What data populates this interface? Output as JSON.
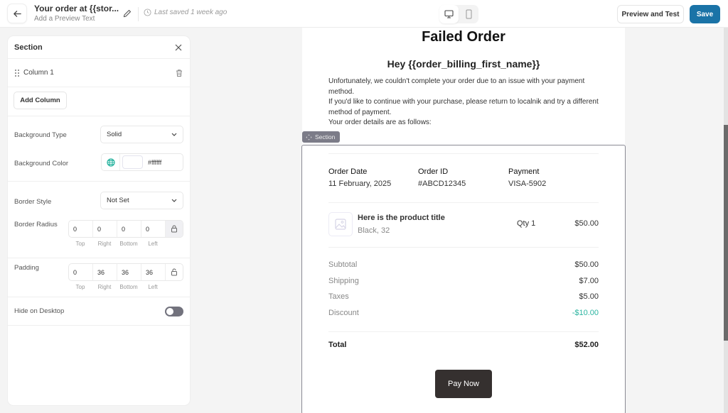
{
  "topbar": {
    "title": "Your order at {{stor...",
    "subtitle": "Add a Preview Text",
    "last_saved": "Last saved 1 week ago",
    "preview_label": "Preview and Test",
    "save_label": "Save",
    "active_device": "desktop"
  },
  "panel": {
    "title": "Section",
    "column_label": "Column 1",
    "add_column_label": "Add Column",
    "background_type": {
      "label": "Background Type",
      "value": "Solid"
    },
    "background_color": {
      "label": "Background Color",
      "value": "#ffffff"
    },
    "border_style": {
      "label": "Border Style",
      "value": "Not Set"
    },
    "border_radius": {
      "label": "Border Radius",
      "values": [
        "0",
        "0",
        "0",
        "0"
      ],
      "sides": [
        "Top",
        "Right",
        "Bottom",
        "Left"
      ],
      "locked": true
    },
    "padding": {
      "label": "Padding",
      "values": [
        "0",
        "36",
        "36",
        "36"
      ],
      "sides": [
        "Top",
        "Right",
        "Bottom",
        "Left"
      ],
      "locked": false
    },
    "hide_on_desktop": {
      "label": "Hide on Desktop",
      "enabled": false
    }
  },
  "email": {
    "title": "Failed Order",
    "greeting": "Hey {{order_billing_first_name}}",
    "body_lines": [
      " Unfortunately, we couldn't complete your order due to an issue with your payment method.",
      "If you'd like to continue with your purchase, please return to localnik and try a different method of payment.",
      "Your order details are as follows:"
    ],
    "section_tag": "Section",
    "meta": [
      {
        "label": "Order Date",
        "value": "11 February, 2025"
      },
      {
        "label": "Order ID",
        "value": "#ABCD12345"
      },
      {
        "label": "Payment",
        "value": "VISA-5902"
      }
    ],
    "product": {
      "title": "Here is the product title",
      "variant": "Black, 32",
      "qty": "Qty 1",
      "price": "$50.00"
    },
    "summary": [
      {
        "label": "Subtotal",
        "value": "$50.00"
      },
      {
        "label": "Shipping",
        "value": "$7.00"
      },
      {
        "label": "Taxes",
        "value": "$5.00"
      },
      {
        "label": "Discount",
        "value": "-$10.00"
      }
    ],
    "total": {
      "label": "Total",
      "value": "$52.00"
    },
    "pay_button": "Pay Now"
  },
  "colors": {
    "primary": "#1a73a7",
    "discount": "#2bb4a0",
    "pay_button": "#35302f",
    "accent_globe": "#2bb4a0"
  }
}
